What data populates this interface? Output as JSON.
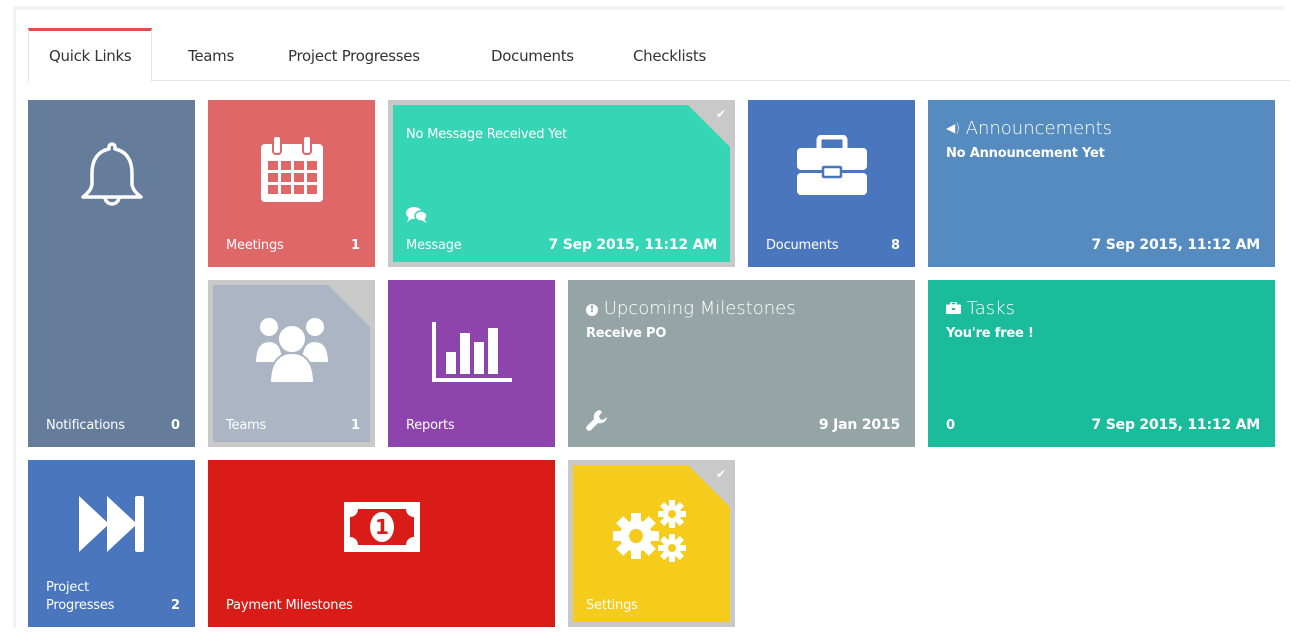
{
  "tabs": [
    {
      "label": "Quick Links",
      "active": true
    },
    {
      "label": "Teams",
      "active": false
    },
    {
      "label": "Project Progresses",
      "active": false
    },
    {
      "label": "Documents",
      "active": false
    },
    {
      "label": "Checklists",
      "active": false
    }
  ],
  "tiles": {
    "notifications": {
      "label": "Notifications",
      "count": "0",
      "icon": "bell-icon",
      "color": "#657d9b"
    },
    "meetings": {
      "label": "Meetings",
      "count": "1",
      "icon": "calendar-icon",
      "color": "#e06767"
    },
    "message": {
      "title": "No Message Received Yet",
      "label": "Message",
      "date": "7 Sep 2015, 11:12 AM",
      "icon": "comments-icon",
      "color": "#35d5b5"
    },
    "documents": {
      "label": "Documents",
      "count": "8",
      "icon": "briefcase-icon",
      "color": "#4a76bd"
    },
    "announcements": {
      "icon_glyph": "🔊",
      "title": "Announcements",
      "subtitle": "No Announcement Yet",
      "date": "7 Sep 2015, 11:12 AM",
      "color": "#558bbe"
    },
    "teams": {
      "label": "Teams",
      "count": "1",
      "icon": "users-icon",
      "color": "#abb5c3"
    },
    "reports": {
      "label": "Reports",
      "icon": "bar-chart-icon",
      "color": "#8e44ad"
    },
    "milestones": {
      "title": "Upcoming Milestones",
      "subtitle": "Receive PO",
      "date": "9 Jan 2015",
      "icon": "wrench-icon",
      "color": "#95a5a5"
    },
    "tasks": {
      "title": "Tasks",
      "subtitle": "You're free !",
      "count": "0",
      "date": "7 Sep 2015, 11:12 AM",
      "color": "#1bbc9b"
    },
    "project_progresses": {
      "label_line1": "Project",
      "label_line2": "Progresses",
      "count": "2",
      "icon": "fast-forward-icon",
      "color": "#4a76bd"
    },
    "payment_milestones": {
      "label": "Payment Milestones",
      "icon": "money-icon",
      "color": "#d91c17"
    },
    "settings": {
      "label": "Settings",
      "icon": "gears-icon",
      "color": "#f5cb1c"
    }
  }
}
